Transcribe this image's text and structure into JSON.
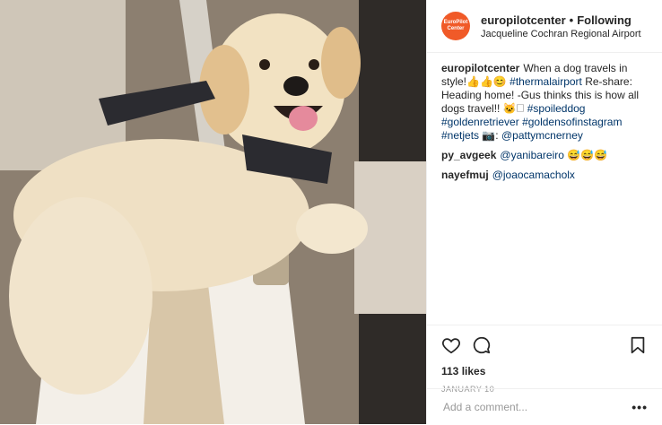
{
  "post": {
    "username": "europilotcenter",
    "follow_separator": "•",
    "follow_status": "Following",
    "location": "Jacqueline Cochran Regional Airport",
    "avatar_text": "EuroPilot Center",
    "photo_description_icon": "dog-photo",
    "caption": {
      "user": "europilotcenter",
      "text_1": "When a dog travels in style!👍👍😊 ",
      "tag_1": "#thermalairport",
      "text_2": " Re-share: Heading home! -Gus thinks this is how all dogs travel!! 🐱🗆 ",
      "tag_2": "#spoileddog",
      "tag_3": "#goldenretriever",
      "tag_4": "#goldensofinstagram",
      "tag_5": "#netjets",
      "text_3": " 📷: ",
      "tag_6": "@pattymcnerney"
    },
    "comments": [
      {
        "user": "py_avgeek",
        "mention": "@yanibareiro",
        "text": " 😅😅😅"
      },
      {
        "user": "nayefmuj",
        "mention": "@joaocamacholx",
        "text": ""
      }
    ],
    "likes": "113 likes",
    "date": "JANUARY 10",
    "comment_placeholder": "Add a comment...",
    "more_label": "•••"
  },
  "colors": {
    "accent_avatar": "#f05a28",
    "link": "#003569"
  }
}
